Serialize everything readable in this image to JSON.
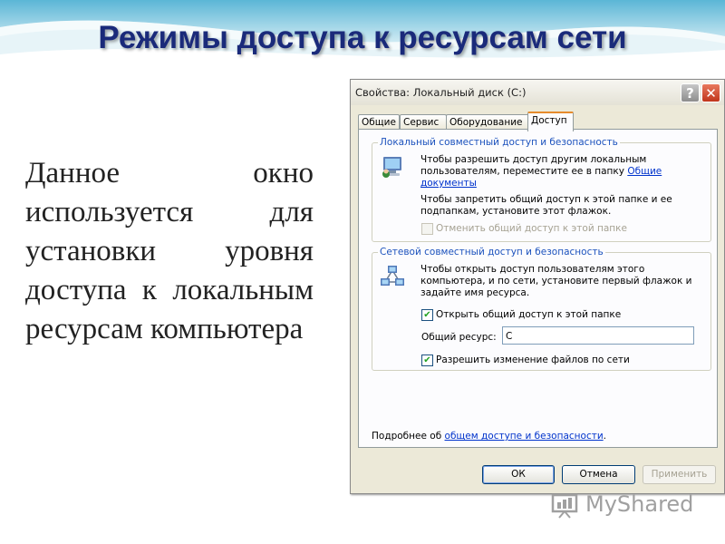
{
  "slide": {
    "title": "Режимы доступа к ресурсам сети",
    "body": "Данное окно используется для установки уровня доступа к локальным ресурсам компьютера"
  },
  "dialog": {
    "title": "Свойства: Локальный диск (С:)",
    "help_label": "?",
    "close_label": "✕",
    "tabs": [
      {
        "label": "Общие"
      },
      {
        "label": "Сервис"
      },
      {
        "label": "Оборудование"
      },
      {
        "label": "Доступ",
        "active": true
      }
    ],
    "local_group": {
      "legend": "Локальный совместный доступ и безопасность",
      "text1": "Чтобы разрешить доступ другим локальным пользователям, переместите ее в папку ",
      "text1_link": "Общие документы",
      "text2": "Чтобы запретить общий доступ к этой папке и ее подпапкам, установите этот флажок.",
      "checkbox_label": "Отменить общий доступ к этой папке",
      "checkbox_checked": false,
      "checkbox_enabled": false
    },
    "network_group": {
      "legend": "Сетевой совместный доступ и безопасность",
      "text": "Чтобы открыть доступ пользователям этого компьютера, и по сети, установите первый флажок и задайте имя ресурса.",
      "share_checkbox_label": "Открыть общий доступ к этой папке",
      "share_checkbox_checked": true,
      "share_name_label": "Общий ресурс:",
      "share_name_value": "C",
      "allow_changes_label": "Разрешить изменение файлов по сети",
      "allow_changes_checked": true
    },
    "more_info_prefix": "Подробнее об ",
    "more_info_link": "общем доступе и безопасности",
    "more_info_suffix": ".",
    "buttons": {
      "ok": "ОК",
      "cancel": "Отмена",
      "apply": "Применить"
    }
  },
  "watermark": {
    "text": "MyShared"
  },
  "icons": {
    "help": "help-icon",
    "close": "close-icon",
    "local_users": "computer-users-icon",
    "network": "network-icon",
    "logo": "myshared-logo-icon"
  }
}
